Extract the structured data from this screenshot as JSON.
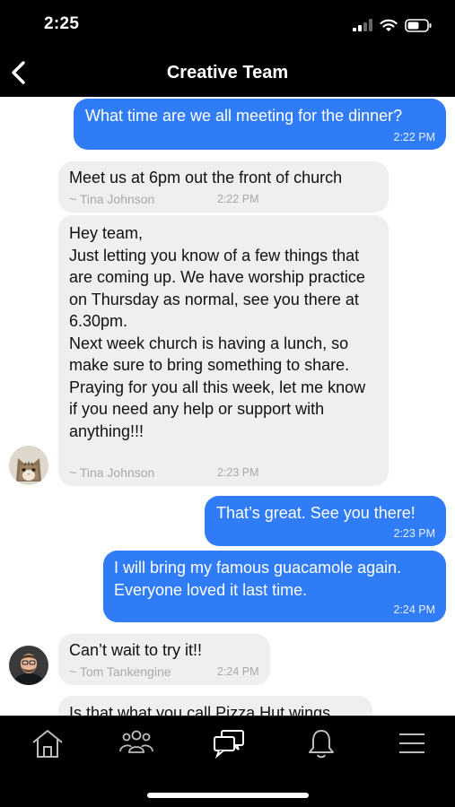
{
  "status": {
    "time": "2:25"
  },
  "header": {
    "title": "Creative Team"
  },
  "messages": [
    {
      "dir": "out",
      "text": "What time are we all meeting for the dinner?",
      "time": "2:22 PM"
    },
    {
      "dir": "in",
      "text": "Meet us at 6pm out the front of church",
      "sender": "~ Tina Johnson",
      "time": "2:22 PM"
    },
    {
      "dir": "in",
      "text": "Hey team,\nJust letting you know of a few things that are coming up. We have worship practice on Thursday as normal, see you there at 6.30pm.\nNext week church is having a lunch, so make sure to bring something to share.\nPraying for you all this week, let me know if you need any help or support with anything!!!",
      "sender": "~ Tina Johnson",
      "time": "2:23 PM"
    },
    {
      "dir": "out",
      "text": "That’s great. See you there!",
      "time": "2:23 PM"
    },
    {
      "dir": "out",
      "text": "I will bring my famous guacamole again. Everyone loved it last time.",
      "time": "2:24 PM"
    },
    {
      "dir": "in",
      "text": "Can’t wait to try it!!",
      "sender": "~ Tom Tankengine",
      "time": "2:24 PM"
    },
    {
      "dir": "in",
      "text": "Is that what you call Pizza Hut wings",
      "sender": "",
      "time": ""
    }
  ],
  "tabs": [
    "home-icon",
    "people-icon",
    "chat-icon",
    "bell-icon",
    "menu-icon"
  ],
  "colors": {
    "accent": "#2f7cf6",
    "incoming_bubble": "#efefef",
    "bar": "#000000"
  }
}
